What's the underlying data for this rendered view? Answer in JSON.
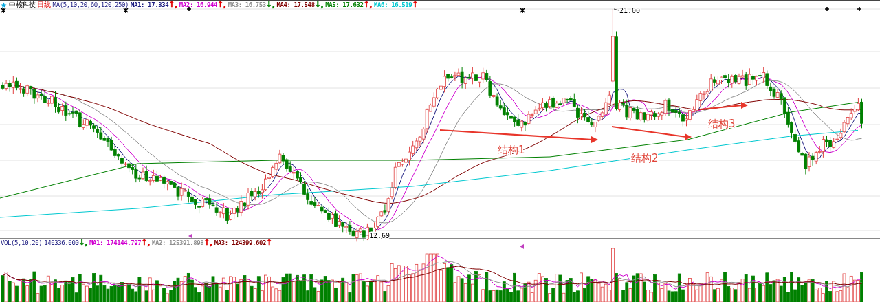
{
  "chart_header": {
    "stock_name": "中核科技",
    "period": "日线",
    "indicator": "MA(5,10,20,60,120,250)",
    "items": [
      {
        "text": "MA1: 17.334",
        "arrow": {
          "text": "↑,",
          "color": "#e00000"
        },
        "color": "#1c1c80"
      },
      {
        "text": "MA2: 16.944",
        "arrow": {
          "text": "↑,",
          "color": "#e00000"
        },
        "color": "#d000d0"
      },
      {
        "text": "MA3: 16.753",
        "arrow": {
          "text": "↓,",
          "color": "#008000"
        },
        "color": "#909090"
      },
      {
        "text": "MA4: 17.548",
        "arrow": {
          "text": "↓,",
          "color": "#008000"
        },
        "color": "#800000"
      },
      {
        "text": "MA5: 17.632",
        "arrow": {
          "text": "↑,",
          "color": "#e00000"
        },
        "color": "#008000"
      },
      {
        "text": "MA6: 16.519",
        "arrow": {
          "text": "↑",
          "color": "#e00000"
        },
        "color": "#00c8d0"
      }
    ]
  },
  "price_labels": [
    {
      "kind": "high",
      "text": "21.00"
    },
    {
      "kind": "low",
      "text": "12.69"
    }
  ],
  "annotations": [
    {
      "text": "结构1"
    },
    {
      "text": "结构2"
    },
    {
      "text": "结构3"
    }
  ],
  "volume_header": {
    "indicator": "VOL(5,10,20)",
    "value": "140336.000",
    "arrow": {
      "text": "↓,",
      "color": "#008000"
    },
    "items": [
      {
        "text": "MA1: 174144.797",
        "arrow": {
          "text": "↑,",
          "color": "#e00000"
        },
        "color": "#d000d0"
      },
      {
        "text": "MA2: 125391.898",
        "arrow": {
          "text": "↑,",
          "color": "#e00000"
        },
        "color": "#909090"
      },
      {
        "text": "MA3: 124399.602",
        "arrow": {
          "text": "↑",
          "color": "#e00000"
        },
        "color": "#800000"
      }
    ]
  }
}
